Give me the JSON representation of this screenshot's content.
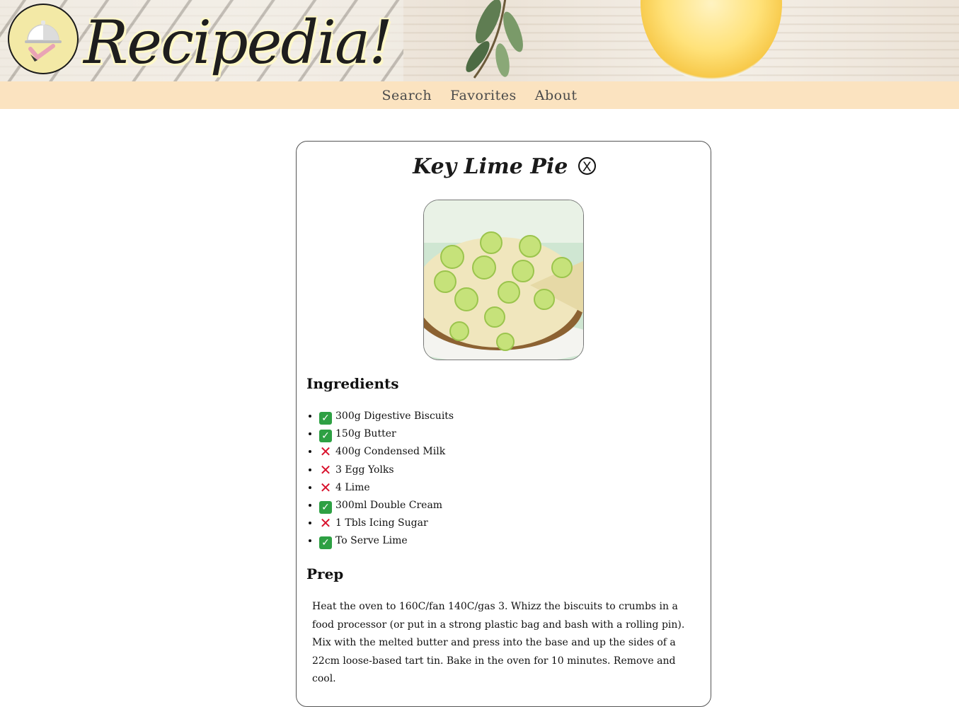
{
  "site": {
    "title": "Recipedia!"
  },
  "nav": {
    "items": [
      "Search",
      "Favorites",
      "About"
    ]
  },
  "recipe": {
    "title": "Key Lime Pie",
    "close_symbol": "X",
    "ingredients_heading": "Ingredients",
    "ingredients": [
      {
        "text": "300g Digestive Biscuits",
        "have": true
      },
      {
        "text": "150g Butter",
        "have": true
      },
      {
        "text": "400g Condensed Milk",
        "have": false
      },
      {
        "text": "3 Egg Yolks",
        "have": false
      },
      {
        "text": "4 Lime",
        "have": false
      },
      {
        "text": "300ml Double Cream",
        "have": true
      },
      {
        "text": "1 Tbls Icing Sugar",
        "have": false
      },
      {
        "text": "To Serve Lime",
        "have": true
      }
    ],
    "prep_heading": "Prep",
    "prep_text": "Heat the oven to 160C/fan 140C/gas 3. Whizz the biscuits to crumbs in a food processor (or put in a strong plastic bag and bash with a rolling pin). Mix with the melted butter and press into the base and up the sides of a 22cm loose-based tart tin. Bake in the oven for 10 minutes. Remove and cool."
  },
  "colors": {
    "nav_bg": "#fbe3c0",
    "check": "#2ea043",
    "cross": "#d8112c"
  }
}
